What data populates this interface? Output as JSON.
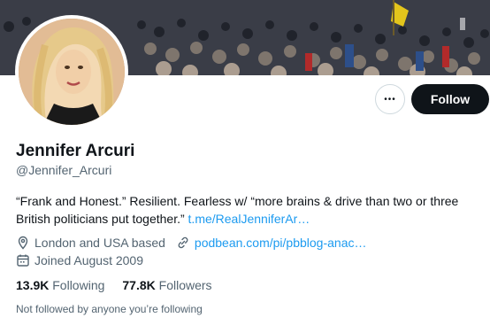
{
  "profile": {
    "name": "Jennifer Arcuri",
    "handle": "@Jennifer_Arcuri",
    "bio_text": "“Frank and Honest.” Resilient. Fearless w/ “more brains & drive than two or three British politicians put together.” ",
    "bio_link": "t.me/RealJenniferAr…",
    "location": "London and USA based",
    "website": "podbean.com/pi/pbblog-anac…",
    "joined": "Joined August 2009"
  },
  "actions": {
    "more_label": "•••",
    "follow_label": "Follow"
  },
  "stats": {
    "following_count": "13.9K",
    "following_label": "Following",
    "followers_count": "77.8K",
    "followers_label": "Followers"
  },
  "footer": {
    "not_followed": "Not followed by anyone you’re following"
  },
  "colors": {
    "link": "#1d9bf0",
    "secondary_text": "#536471",
    "primary_text": "#0f1419"
  },
  "icons": [
    "location-icon",
    "link-icon",
    "calendar-icon",
    "more-icon"
  ]
}
